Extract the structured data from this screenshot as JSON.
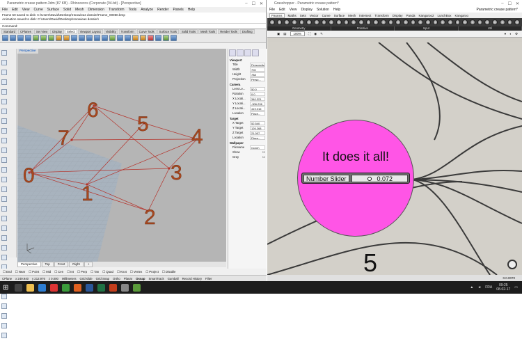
{
  "rhino": {
    "title": "Parametric crease pattern.3dm (87 KB) - Rhinoceros (Corporate (94-bit) - [Perspective]",
    "menu": [
      "File",
      "Edit",
      "View",
      "Curve",
      "Surface",
      "Solid",
      "Mesh",
      "Dimension",
      "Transform",
      "Tools",
      "Analyze",
      "Render",
      "Panels",
      "Help"
    ],
    "command_history": [
      "Frame 50 saved to disk: C:\\Users\\David\\Desktop\\Hoowieas dossier\\Frame_00050.bmp",
      "Animation saved to disk: C:\\Users\\David\\Desktop\\Hoowieas dossier\\"
    ],
    "command_prompt": "Command:",
    "toolbar_tabs": [
      "Standard",
      "CPlanes",
      "Set View",
      "Display",
      "Select",
      "Viewport Layout",
      "Visibility",
      "Transform",
      "Curve Tools",
      "Surface Tools",
      "Solid Tools",
      "Mesh Tools",
      "Render Tools",
      "Drafting"
    ],
    "viewport_title": "Perspective",
    "points": [
      "0",
      "1",
      "2",
      "3",
      "4",
      "5",
      "6",
      "7"
    ],
    "properties": {
      "viewport_header": "Viewport",
      "title_label": "Title",
      "title_value": "Perspective",
      "width_label": "Width",
      "width_value": "700",
      "height_label": "Height",
      "height_value": "788",
      "projection_label": "Projection",
      "projection_value": "Persp...",
      "camera_header": "Camera",
      "lens_label": "Lens Le...",
      "lens_value": "50.0",
      "rotation_label": "Rotation",
      "rotation_value": "0.0",
      "xloc_label": "X Locati...",
      "xloc_value": "340.321",
      "yloc_label": "Y Locati...",
      "yloc_value": "-306.296",
      "zloc_label": "Z Locati...",
      "zloc_value": "419.016",
      "location_label": "Location",
      "location_value": "Place...",
      "target_header": "Target",
      "xt_label": "X Target",
      "xt_value": "52.540",
      "yt_label": "Y Target",
      "yt_value": "126.268",
      "zt_label": "Z Target",
      "zt_value": "21.007",
      "tloc_label": "Location",
      "tloc_value": "Place...",
      "wallpaper_header": "Wallpaper",
      "filename_label": "Filename",
      "filename_value": "(none)",
      "show_label": "Show",
      "gray_label": "Gray"
    },
    "viewport_tabs": [
      "Perspective",
      "Top",
      "Front",
      "Right",
      "+"
    ],
    "osnaps": [
      "End",
      "Near",
      "Point",
      "Mid",
      "Cen",
      "Int",
      "Perp",
      "Tan",
      "Quad",
      "Knot",
      "Vertex",
      "Project",
      "Disable"
    ],
    "status": [
      "CPlane",
      "x 249.940",
      "y 212.976",
      "z 0.000",
      "Millimeters",
      "Grid slide",
      "Grid Snap",
      "Ortho",
      "Planar",
      "Osnap",
      "SmartTrack",
      "Gumball",
      "Record History",
      "Filter"
    ]
  },
  "gh": {
    "title": "Grasshopper - Parametric crease pattern*",
    "title_right": "Parametric crease pattern*",
    "menu": [
      "File",
      "Edit",
      "View",
      "Display",
      "Solution",
      "Help"
    ],
    "tabs": [
      "Params",
      "Maths",
      "Sets",
      "Vector",
      "Curve",
      "Surface",
      "Mesh",
      "Intersect",
      "Transform",
      "Display",
      "Panda",
      "Kangaroo2",
      "LunchBox",
      "Kangaroo"
    ],
    "groups": [
      "Geometry",
      "Primitive",
      "Input",
      "Util"
    ],
    "zoom": "100%",
    "bubble_text": "It does it all!",
    "slider_label": "Number Slider",
    "slider_value": "0.072",
    "panel_value": "5",
    "status_version": "0.0.0070"
  },
  "taskbar": {
    "lang": "FRA",
    "time": "09:25",
    "date": "08-02-17"
  }
}
